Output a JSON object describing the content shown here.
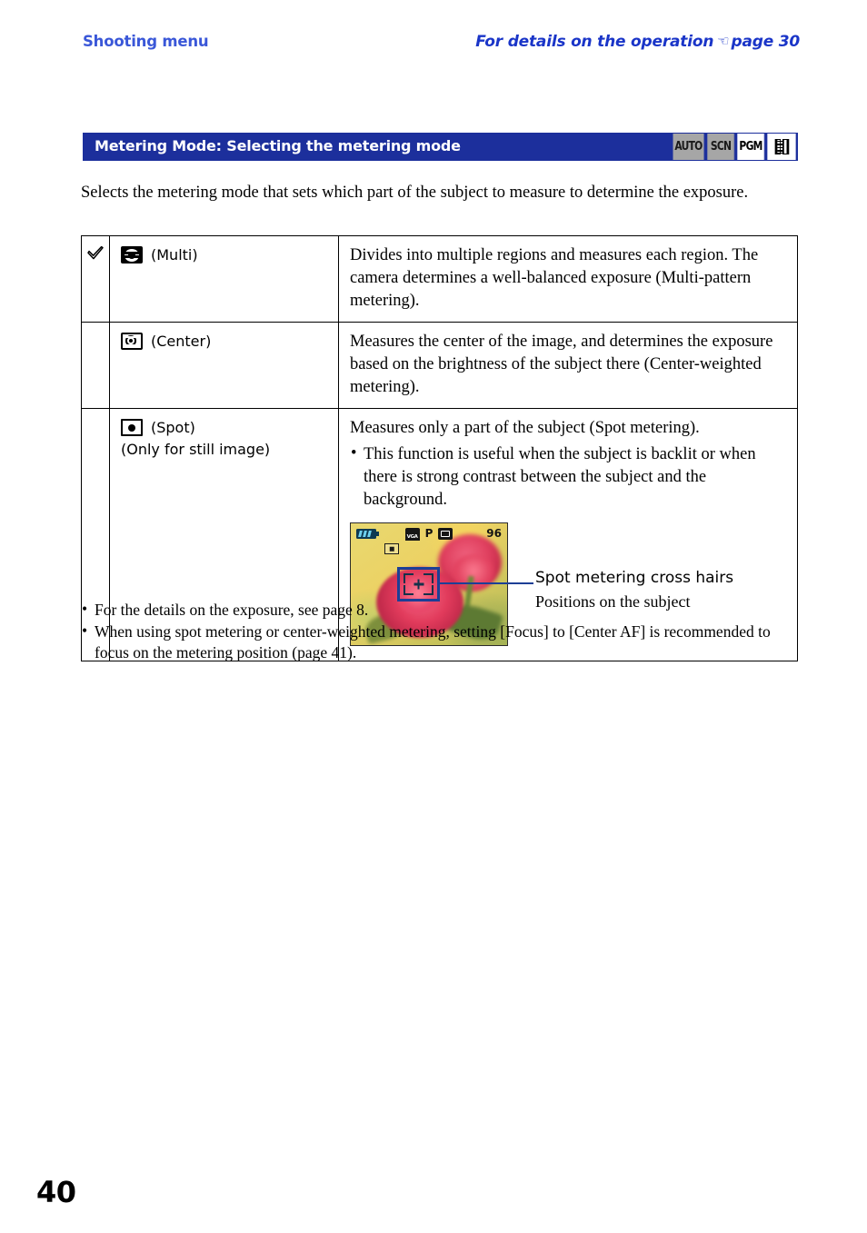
{
  "running_head": {
    "left": "Shooting menu",
    "right_prefix": "For details on the operation",
    "right_hand_icon": "pointing-hand-icon",
    "right_suffix": "page 30"
  },
  "section": {
    "title": "Metering Mode: Selecting the metering mode",
    "mode_badges": [
      {
        "label": "AUTO",
        "state": "inactive"
      },
      {
        "label": "SCN",
        "state": "inactive"
      },
      {
        "label": "PGM",
        "state": "active"
      },
      {
        "label": "",
        "state": "active",
        "icon": "movie-film-icon"
      }
    ]
  },
  "intro": "Selects the metering mode that sets which part of the subject to measure to determine the exposure.",
  "table": {
    "rows": [
      {
        "checked": true,
        "check_icon": "checkmark-icon",
        "mode_icon": "metering-multi-icon",
        "mode_label": "(Multi)",
        "mode_sublabel": "",
        "description": "Divides into multiple regions and measures each region. The camera determines a well-balanced exposure (Multi-pattern metering).",
        "bullets": []
      },
      {
        "checked": false,
        "check_icon": "",
        "mode_icon": "metering-center-icon",
        "mode_label": "(Center)",
        "mode_sublabel": "",
        "description": "Measures the center of the image, and determines the exposure based on the brightness of the subject there (Center-weighted metering).",
        "bullets": []
      },
      {
        "checked": false,
        "check_icon": "",
        "mode_icon": "metering-spot-icon",
        "mode_label": "(Spot)",
        "mode_sublabel": "(Only for still image)",
        "description": "Measures only a part of the subject (Spot metering).",
        "bullets": [
          "This function is useful when the subject is backlit or when there is strong contrast between the subject and the background."
        ]
      }
    ]
  },
  "illustration": {
    "lcd": {
      "battery_icon": "battery-icon",
      "image_size_icon": "vga-image-size-icon",
      "image_size_label": "VGA",
      "mode_letter": "P",
      "storage_icon": "memory-card-icon",
      "shots_remaining": "96",
      "spot_indicator_icon": "spot-metering-indicator-icon",
      "crosshair_icon": "spot-metering-crosshair-icon"
    },
    "callout_primary": "Spot metering cross hairs",
    "callout_secondary": "Positions on the subject"
  },
  "footnotes": [
    "For the details on the exposure, see page 8.",
    "When using spot metering or center-weighted metering, setting [Focus] to [Center AF] is recommended to focus on the metering position (page 41)."
  ],
  "folio": "40",
  "colors": {
    "header_blue": "#1c2f9c",
    "running_head_blue": "#3a57d8",
    "callout_blue": "#1d3f96",
    "badge_inactive": "#a6a6a6"
  }
}
